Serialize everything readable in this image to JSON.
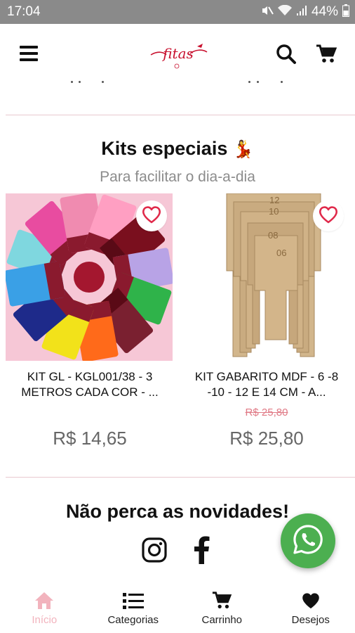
{
  "status_bar": {
    "time": "17:04",
    "battery": "44%",
    "icons": [
      "mute-icon",
      "wifi-icon",
      "signal-icon",
      "battery-icon"
    ]
  },
  "header": {
    "logo_text": "fitas",
    "icons": [
      "menu-icon",
      "search-icon",
      "cart-icon"
    ]
  },
  "section": {
    "title": "Kits especiais",
    "title_emoji": "💃",
    "subtitle": "Para facilitar o dia-a-dia"
  },
  "products": [
    {
      "name": "KIT GL - KGL001/38 - 3 METROS CADA COR - ...",
      "old_price": "",
      "price": "R$  14,65",
      "wishlist_icon": "heart-outline-icon"
    },
    {
      "name": "KIT GABARITO MDF - 6 -8 -10 - 12 E 14 CM - A...",
      "old_price": "R$ 25,80",
      "price": "R$  25,80",
      "wishlist_icon": "heart-outline-icon",
      "image_labels": [
        "12",
        "10",
        "08",
        "06"
      ]
    }
  ],
  "newsletter": {
    "title": "Não perca as novidades!",
    "social": [
      "instagram-icon",
      "facebook-icon"
    ]
  },
  "fab": {
    "icon": "whatsapp-icon"
  },
  "bottom_nav": {
    "items": [
      {
        "label": "Início",
        "icon": "home-icon",
        "active": true
      },
      {
        "label": "Categorias",
        "icon": "list-icon",
        "active": false
      },
      {
        "label": "Carrinho",
        "icon": "cart-icon",
        "active": false
      },
      {
        "label": "Desejos",
        "icon": "heart-icon",
        "active": false
      }
    ]
  },
  "colors": {
    "accent_pink": "#f2b3bd",
    "old_price": "#e07a86",
    "heart": "#e0294a",
    "whatsapp": "#4caf50",
    "status_bar": "#8a8a8a"
  }
}
